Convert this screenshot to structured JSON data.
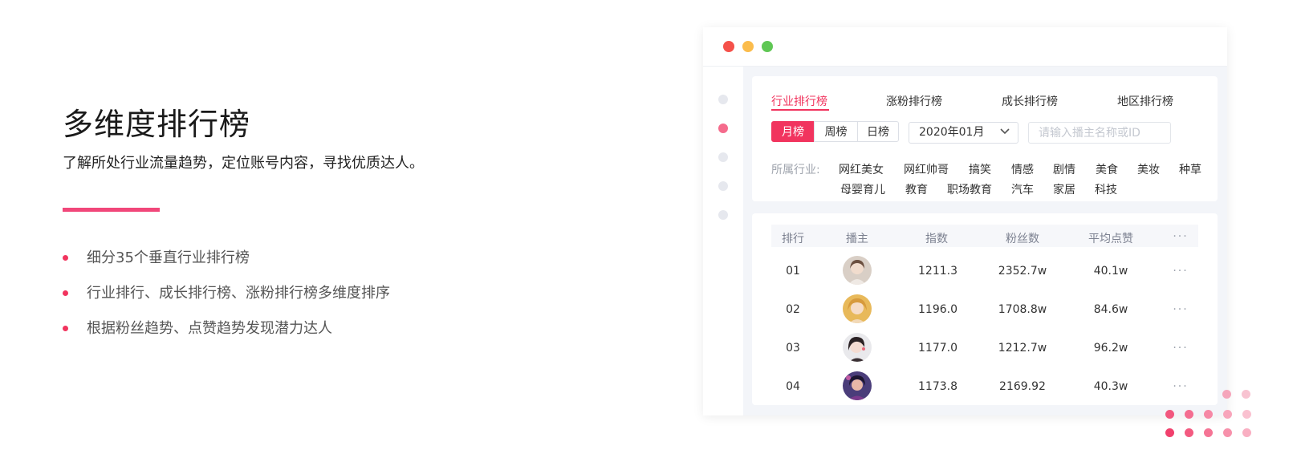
{
  "feature": {
    "title": "多维度排行榜",
    "subtitle": "了解所处行业流量趋势，定位账号内容，寻找优质达人。",
    "bullets": [
      "细分35个垂直行业排行榜",
      "行业排行、成长排行榜、涨粉排行榜多维度排序",
      "根据粉丝趋势、点赞趋势发现潜力达人"
    ]
  },
  "colors": {
    "accent": "#f1345e",
    "divider": "#f1477a",
    "traffic_red": "#f5514a",
    "traffic_yellow": "#fbbc4c",
    "traffic_green": "#5fc754"
  },
  "app": {
    "tabs": [
      "行业排行榜",
      "涨粉排行榜",
      "成长排行榜",
      "地区排行榜"
    ],
    "period_buttons": [
      "月榜",
      "周榜",
      "日榜"
    ],
    "selected_month": "2020年01月",
    "search_placeholder": "请输入播主名称或ID",
    "industry_label": "所属行业:",
    "industries": [
      "网红美女",
      "网红帅哥",
      "搞笑",
      "情感",
      "剧情",
      "美食",
      "美妆",
      "种草",
      "母婴育儿",
      "教育",
      "职场教育",
      "汽车",
      "家居",
      "科技"
    ],
    "table": {
      "columns": [
        "排行",
        "播主",
        "指数",
        "粉丝数",
        "平均点赞",
        "···"
      ],
      "rows": [
        {
          "rank": "01",
          "index": "1211.3",
          "fans": "2352.7w",
          "avg_likes": "40.1w",
          "more": "···"
        },
        {
          "rank": "02",
          "index": "1196.0",
          "fans": "1708.8w",
          "avg_likes": "84.6w",
          "more": "···"
        },
        {
          "rank": "03",
          "index": "1177.0",
          "fans": "1212.7w",
          "avg_likes": "96.2w",
          "more": "···"
        },
        {
          "rank": "04",
          "index": "1173.8",
          "fans": "2169.92",
          "avg_likes": "40.3w",
          "more": "···"
        }
      ]
    }
  }
}
